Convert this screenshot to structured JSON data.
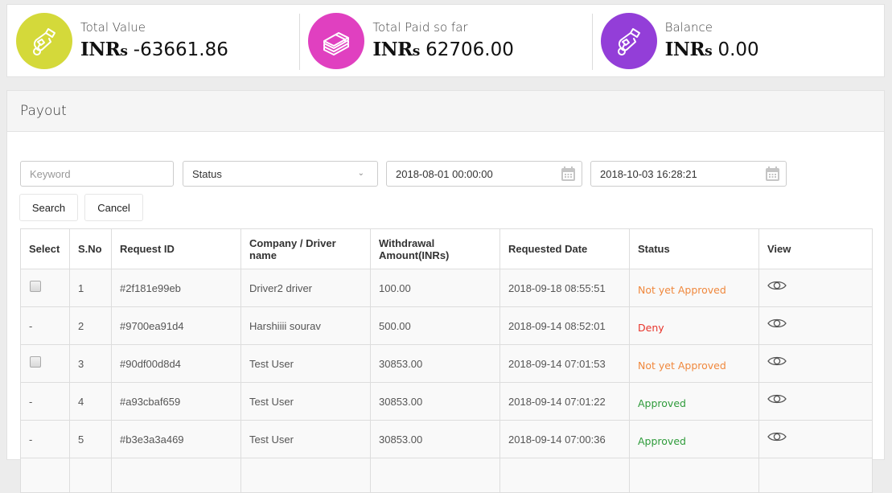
{
  "stats": [
    {
      "label": "Total Value",
      "currency": "INR",
      "currency_suffix": "s",
      "amount": "-63661.86",
      "icon": "hand-coin-icon",
      "color": "#d4d93a"
    },
    {
      "label": "Total Paid so far",
      "currency": "INR",
      "currency_suffix": "s",
      "amount": "62706.00",
      "icon": "money-stack-icon",
      "color": "#e040c0"
    },
    {
      "label": "Balance",
      "currency": "INR",
      "currency_suffix": "s",
      "amount": "0.00",
      "icon": "hand-coin-icon",
      "color": "#933ed8"
    }
  ],
  "payout": {
    "title": "Payout",
    "filters": {
      "keyword_placeholder": "Keyword",
      "keyword_value": "",
      "status_selected": "Status",
      "date_from": "2018-08-01 00:00:00",
      "date_to": "2018-10-03 16:28:21"
    },
    "buttons": {
      "search": "Search",
      "cancel": "Cancel"
    },
    "table": {
      "headers": [
        "Select",
        "S.No",
        "Request ID",
        "Company / Driver name",
        "Withdrawal Amount(INRs)",
        "Requested Date",
        "Status",
        "View"
      ],
      "rows": [
        {
          "select": "checkbox",
          "sno": "1",
          "request_id": "#2f181e99eb",
          "name": "Driver2 driver",
          "amount": "100.00",
          "date": "2018-09-18 08:55:51",
          "status": "Not yet Approved",
          "status_kind": "pending"
        },
        {
          "select": "-",
          "sno": "2",
          "request_id": "#9700ea91d4",
          "name": "Harshiiii sourav",
          "amount": "500.00",
          "date": "2018-09-14 08:52:01",
          "status": "Deny",
          "status_kind": "deny"
        },
        {
          "select": "checkbox",
          "sno": "3",
          "request_id": "#90df00d8d4",
          "name": "Test User",
          "amount": "30853.00",
          "date": "2018-09-14 07:01:53",
          "status": "Not yet Approved",
          "status_kind": "pending"
        },
        {
          "select": "-",
          "sno": "4",
          "request_id": "#a93cbaf659",
          "name": "Test User",
          "amount": "30853.00",
          "date": "2018-09-14 07:01:22",
          "status": "Approved",
          "status_kind": "approved"
        },
        {
          "select": "-",
          "sno": "5",
          "request_id": "#b3e3a3a469",
          "name": "Test User",
          "amount": "30853.00",
          "date": "2018-09-14 07:00:36",
          "status": "Approved",
          "status_kind": "approved"
        }
      ]
    },
    "status_colors": {
      "pending": "#f0883d",
      "deny": "#e8342b",
      "approved": "#2e9b3a"
    }
  }
}
